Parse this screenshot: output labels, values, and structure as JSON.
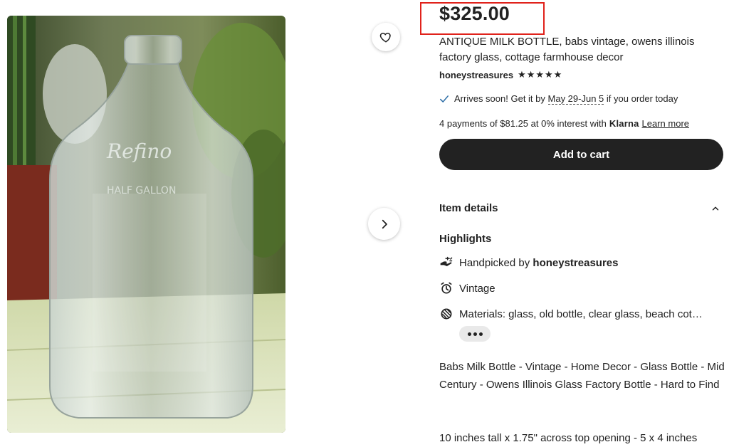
{
  "listing": {
    "price": "$325.00",
    "title": "ANTIQUE MILK BOTTLE, babs vintage, owens illinois factory glass, cottage farmhouse decor",
    "shop_name": "honeystreasures",
    "stars": "★★★★★",
    "rating_value": 5,
    "arrives_prefix": "Arrives soon! Get it by",
    "arrives_dates": "May 29-Jun 5",
    "arrives_suffix": "if you order today",
    "klarna_prefix": "4 payments of $81.25 at 0% interest with",
    "klarna_logo": "Klarna",
    "learn_more": "Learn more",
    "add_to_cart": "Add to cart"
  },
  "details": {
    "heading": "Item details",
    "highlights_heading": "Highlights",
    "handpicked_prefix": "Handpicked by",
    "handpicked_shop": "honeystreasures",
    "vintage": "Vintage",
    "materials": "Materials: glass, old bottle, clear glass, beach cot…",
    "description_1": "Babs Milk Bottle - Vintage - Home Decor - Glass Bottle - Mid Century - Owens Illinois Glass Factory Bottle - Hard to Find",
    "description_2": "10 inches tall x 1.75\" across top opening - 5 x 4 inches"
  },
  "icons": {
    "favorite": "heart-icon",
    "next": "chevron-right-icon",
    "check": "check-icon",
    "collapse": "chevron-up-icon",
    "handpicked": "hand-sparkle-icon",
    "vintage": "alarm-clock-icon",
    "materials": "yarn-ball-icon",
    "more": "more-dots-icon"
  },
  "colors": {
    "highlight_box": "#e0221b",
    "cart_button": "#222222",
    "check": "#2f6fa7"
  }
}
